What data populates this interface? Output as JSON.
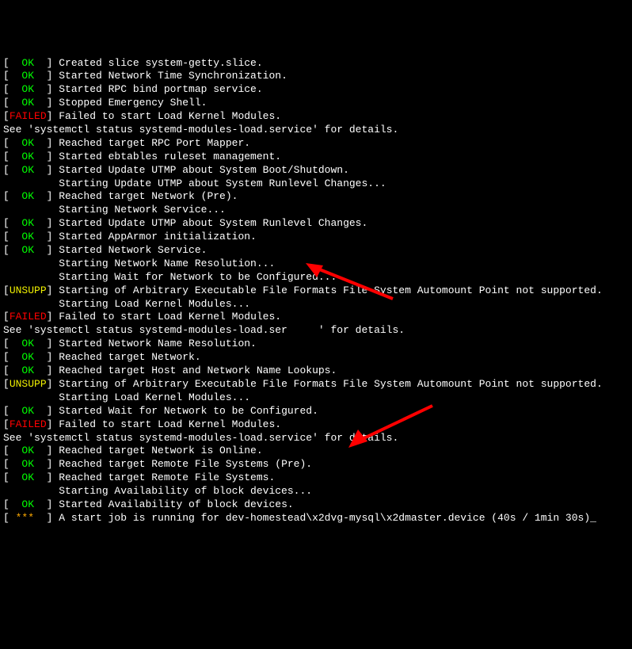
{
  "lines": [
    {
      "status": "OK",
      "text": "Created slice system-getty.slice."
    },
    {
      "status": "OK",
      "text": "Started Network Time Synchronization."
    },
    {
      "status": "OK",
      "text": "Started RPC bind portmap service."
    },
    {
      "status": "OK",
      "text": "Stopped Emergency Shell."
    },
    {
      "status": "FAILED",
      "text": "Failed to start Load Kernel Modules."
    },
    {
      "status": null,
      "text": "See 'systemctl status systemd-modules-load.service' for details."
    },
    {
      "status": "OK",
      "text": "Reached target RPC Port Mapper."
    },
    {
      "status": "OK",
      "text": "Started ebtables ruleset management."
    },
    {
      "status": "OK",
      "text": "Started Update UTMP about System Boot/Shutdown."
    },
    {
      "status": null,
      "text": "         Starting Update UTMP about System Runlevel Changes..."
    },
    {
      "status": "OK",
      "text": "Reached target Network (Pre)."
    },
    {
      "status": null,
      "text": "         Starting Network Service..."
    },
    {
      "status": "OK",
      "text": "Started Update UTMP about System Runlevel Changes."
    },
    {
      "status": "OK",
      "text": "Started AppArmor initialization."
    },
    {
      "status": "OK",
      "text": "Started Network Service."
    },
    {
      "status": null,
      "text": "         Starting Network Name Resolution..."
    },
    {
      "status": null,
      "text": "         Starting Wait for Network to be Configured..."
    },
    {
      "status": "UNSUPP",
      "text": "Starting of Arbitrary Executable File Formats File System Automount Point not supported."
    },
    {
      "status": null,
      "text": "         Starting Load Kernel Modules..."
    },
    {
      "status": "FAILED",
      "text": "Failed to start Load Kernel Modules."
    },
    {
      "status": null,
      "text": "See 'systemctl status systemd-modules-load.ser     ' for details."
    },
    {
      "status": "OK",
      "text": "Started Network Name Resolution."
    },
    {
      "status": "OK",
      "text": "Reached target Network."
    },
    {
      "status": "OK",
      "text": "Reached target Host and Network Name Lookups."
    },
    {
      "status": "UNSUPP",
      "text": "Starting of Arbitrary Executable File Formats File System Automount Point not supported."
    },
    {
      "status": null,
      "text": "         Starting Load Kernel Modules..."
    },
    {
      "status": "OK",
      "text": "Started Wait for Network to be Configured."
    },
    {
      "status": "FAILED",
      "text": "Failed to start Load Kernel Modules."
    },
    {
      "status": null,
      "text": "See 'systemctl status systemd-modules-load.service' for details."
    },
    {
      "status": "OK",
      "text": "Reached target Network is Online."
    },
    {
      "status": "OK",
      "text": "Reached target Remote File Systems (Pre)."
    },
    {
      "status": "OK",
      "text": "Reached target Remote File Systems."
    },
    {
      "status": null,
      "text": "         Starting Availability of block devices..."
    },
    {
      "status": "OK",
      "text": "Started Availability of block devices."
    },
    {
      "status": "***",
      "text": "A start job is running for dev-homestead\\x2dvg-mysql\\x2dmaster.device (40s / 1min 30s)_"
    }
  ],
  "status_labels": {
    "OK": "OK",
    "FAILED": "FAILED",
    "UNSUPP": "UNSUPP",
    "***": "***"
  }
}
